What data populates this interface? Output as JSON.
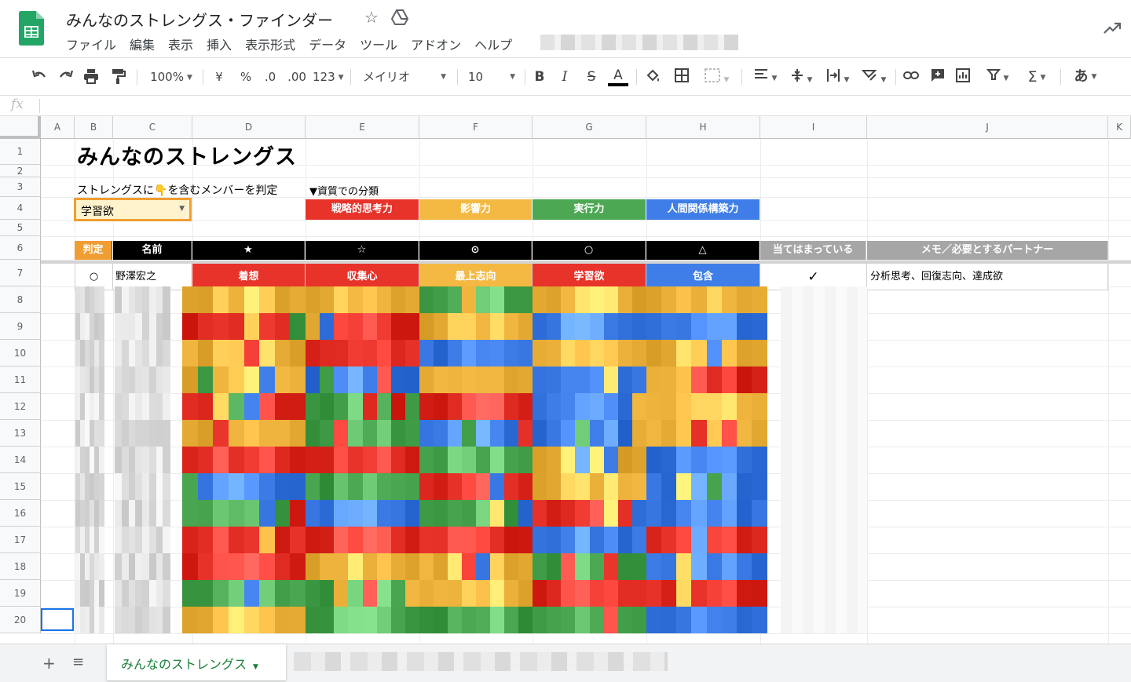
{
  "doc": {
    "title": "みんなのストレングス・ファインダー",
    "menus": [
      "ファイル",
      "編集",
      "表示",
      "挿入",
      "表示形式",
      "データ",
      "ツール",
      "アドオン",
      "ヘルプ"
    ]
  },
  "toolbar": {
    "zoom": "100%",
    "currency": "¥",
    "percent": "%",
    "dec_decrease": ".0",
    "dec_increase": ".00",
    "number_format": "123",
    "font": "メイリオ",
    "font_size": "10",
    "bold": "B",
    "italic": "I",
    "strike": "S",
    "text_color": "A",
    "sum": "Σ",
    "input_tools": "あ"
  },
  "formula_bar": {
    "fx": "fx"
  },
  "columns": [
    "A",
    "B",
    "C",
    "D",
    "E",
    "F",
    "G",
    "H",
    "I",
    "J",
    "K"
  ],
  "rows": [
    "1",
    "2",
    "3",
    "4",
    "5",
    "6",
    "7",
    "8",
    "9",
    "10",
    "11",
    "12",
    "13",
    "14",
    "15",
    "16",
    "17",
    "18",
    "19",
    "20"
  ],
  "sheet": {
    "title": "みんなのストレングス",
    "subtitle_prefix": "ストレングスに",
    "pointer_emoji": "👇",
    "subtitle_suffix": "を含むメンバーを判定",
    "category_heading": "▼資質での分類",
    "dropdown_value": "学習欲",
    "categories": [
      {
        "label": "戦略的思考力",
        "color": "#e8332a"
      },
      {
        "label": "影響力",
        "color": "#f4b942"
      },
      {
        "label": "実行力",
        "color": "#4ca852"
      },
      {
        "label": "人間関係構築力",
        "color": "#3f7ee8"
      }
    ],
    "headers": [
      "判定",
      "名前",
      "★",
      "☆",
      "⊙",
      "○",
      "△",
      "当てはまっている",
      "メモ／必要とするパートナー"
    ],
    "row7": {
      "judge": "○",
      "name": "野澤宏之",
      "strengths": [
        {
          "label": "着想",
          "color": "#e8332a"
        },
        {
          "label": "収集心",
          "color": "#e8332a"
        },
        {
          "label": "最上志向",
          "color": "#f4b942"
        },
        {
          "label": "学習欲",
          "color": "#e8332a"
        },
        {
          "label": "包含",
          "color": "#3f7ee8"
        }
      ],
      "match": "✓",
      "memo": "分析思考、回復志向、達成欲"
    }
  },
  "tabs": {
    "active": "みんなのストレングス"
  },
  "colors": {
    "red": "#e8332a",
    "yellow": "#f4b942",
    "green": "#4ca852",
    "blue": "#3f7ee8",
    "sheets_green": "#188038",
    "selection_blue": "#1a73e8"
  }
}
